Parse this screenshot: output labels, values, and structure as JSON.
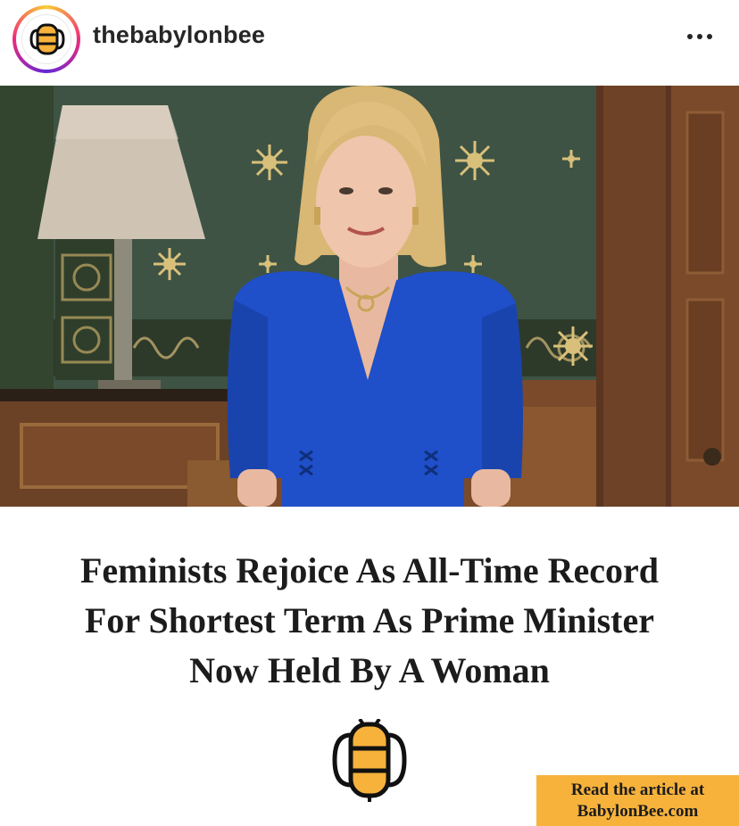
{
  "header": {
    "username": "thebabylonbee",
    "avatar_icon": "babylon-bee-logo-icon",
    "more_icon": "more-options-icon"
  },
  "photo": {
    "description_icon": "article-photo"
  },
  "article": {
    "headline_lines": [
      "Feminists Rejoice As All-Time Record",
      "For Shortest Term As Prime Minister",
      "Now Held By A Woman"
    ]
  },
  "logo": {
    "icon": "babylon-bee-logo-icon"
  },
  "cta": {
    "line1": "Read the article at",
    "line2": "BabylonBee.com"
  },
  "colors": {
    "brand_yellow": "#f7b23b",
    "text_dark": "#1c1c1c",
    "wall_green": "#3d5243",
    "dress_blue": "#1f4fc9",
    "wood": "#7a4a2a"
  }
}
